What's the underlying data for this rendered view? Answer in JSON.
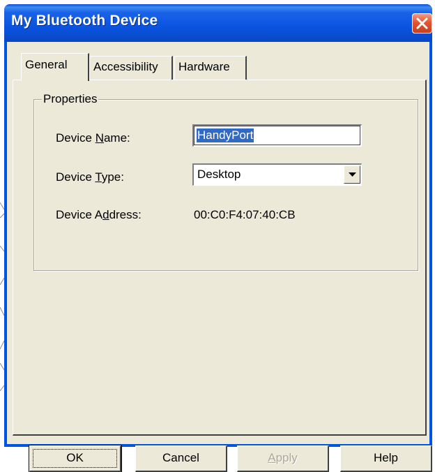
{
  "window": {
    "title": "My Bluetooth Device",
    "close_icon": "close-icon"
  },
  "tabs": [
    {
      "label": "General",
      "active": true
    },
    {
      "label": "Accessibility",
      "active": false
    },
    {
      "label": "Hardware",
      "active": false
    }
  ],
  "properties": {
    "group_title": "Properties",
    "device_name": {
      "label_pre": "Device ",
      "label_mnemonic": "N",
      "label_post": "ame:",
      "value": "HandyPort"
    },
    "device_type": {
      "label_pre": "Device ",
      "label_mnemonic": "T",
      "label_post": "ype:",
      "selected": "Desktop"
    },
    "device_address": {
      "label_pre": "Device A",
      "label_mnemonic": "d",
      "label_post": "dress:",
      "value": "00:C0:F4:07:40:CB"
    }
  },
  "buttons": {
    "ok": "OK",
    "cancel": "Cancel",
    "apply_mnemonic": "A",
    "apply_rest": "pply",
    "help": "Help"
  },
  "colors": {
    "titlebar": "#0054e3",
    "dialog_face": "#ece9d8",
    "selection": "#316ac5",
    "close_button": "#e5542f"
  }
}
